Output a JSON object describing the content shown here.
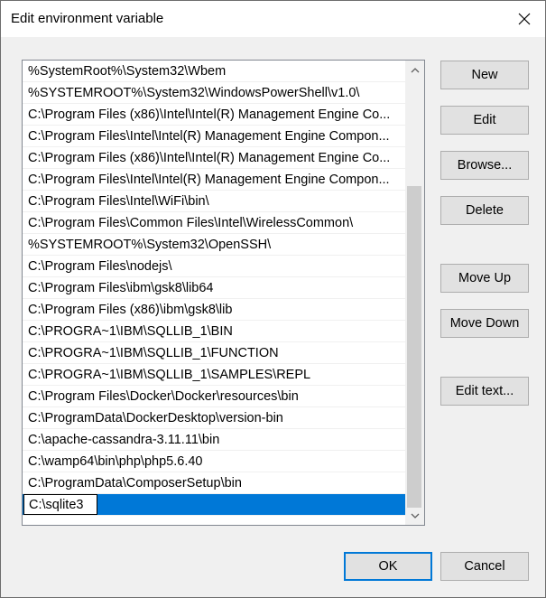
{
  "window": {
    "title": "Edit environment variable"
  },
  "list": {
    "items": [
      "%SystemRoot%\\System32\\Wbem",
      "%SYSTEMROOT%\\System32\\WindowsPowerShell\\v1.0\\",
      "C:\\Program Files (x86)\\Intel\\Intel(R) Management Engine Co...",
      "C:\\Program Files\\Intel\\Intel(R) Management Engine Compon...",
      "C:\\Program Files (x86)\\Intel\\Intel(R) Management Engine Co...",
      "C:\\Program Files\\Intel\\Intel(R) Management Engine Compon...",
      "C:\\Program Files\\Intel\\WiFi\\bin\\",
      "C:\\Program Files\\Common Files\\Intel\\WirelessCommon\\",
      "%SYSTEMROOT%\\System32\\OpenSSH\\",
      "C:\\Program Files\\nodejs\\",
      "C:\\Program Files\\ibm\\gsk8\\lib64",
      "C:\\Program Files (x86)\\ibm\\gsk8\\lib",
      "C:\\PROGRA~1\\IBM\\SQLLIB_1\\BIN",
      "C:\\PROGRA~1\\IBM\\SQLLIB_1\\FUNCTION",
      "C:\\PROGRA~1\\IBM\\SQLLIB_1\\SAMPLES\\REPL",
      "C:\\Program Files\\Docker\\Docker\\resources\\bin",
      "C:\\ProgramData\\DockerDesktop\\version-bin",
      "C:\\apache-cassandra-3.11.11\\bin",
      "C:\\wamp64\\bin\\php\\php5.6.40",
      "C:\\ProgramData\\ComposerSetup\\bin"
    ],
    "editing_value": "C:\\sqlite3"
  },
  "buttons": {
    "new": "New",
    "edit": "Edit",
    "browse": "Browse...",
    "delete": "Delete",
    "move_up": "Move Up",
    "move_down": "Move Down",
    "edit_text": "Edit text...",
    "ok": "OK",
    "cancel": "Cancel"
  },
  "colors": {
    "selection": "#0078d7",
    "dialog_background": "#f0f0f0",
    "default_button_border": "#0078d7"
  }
}
